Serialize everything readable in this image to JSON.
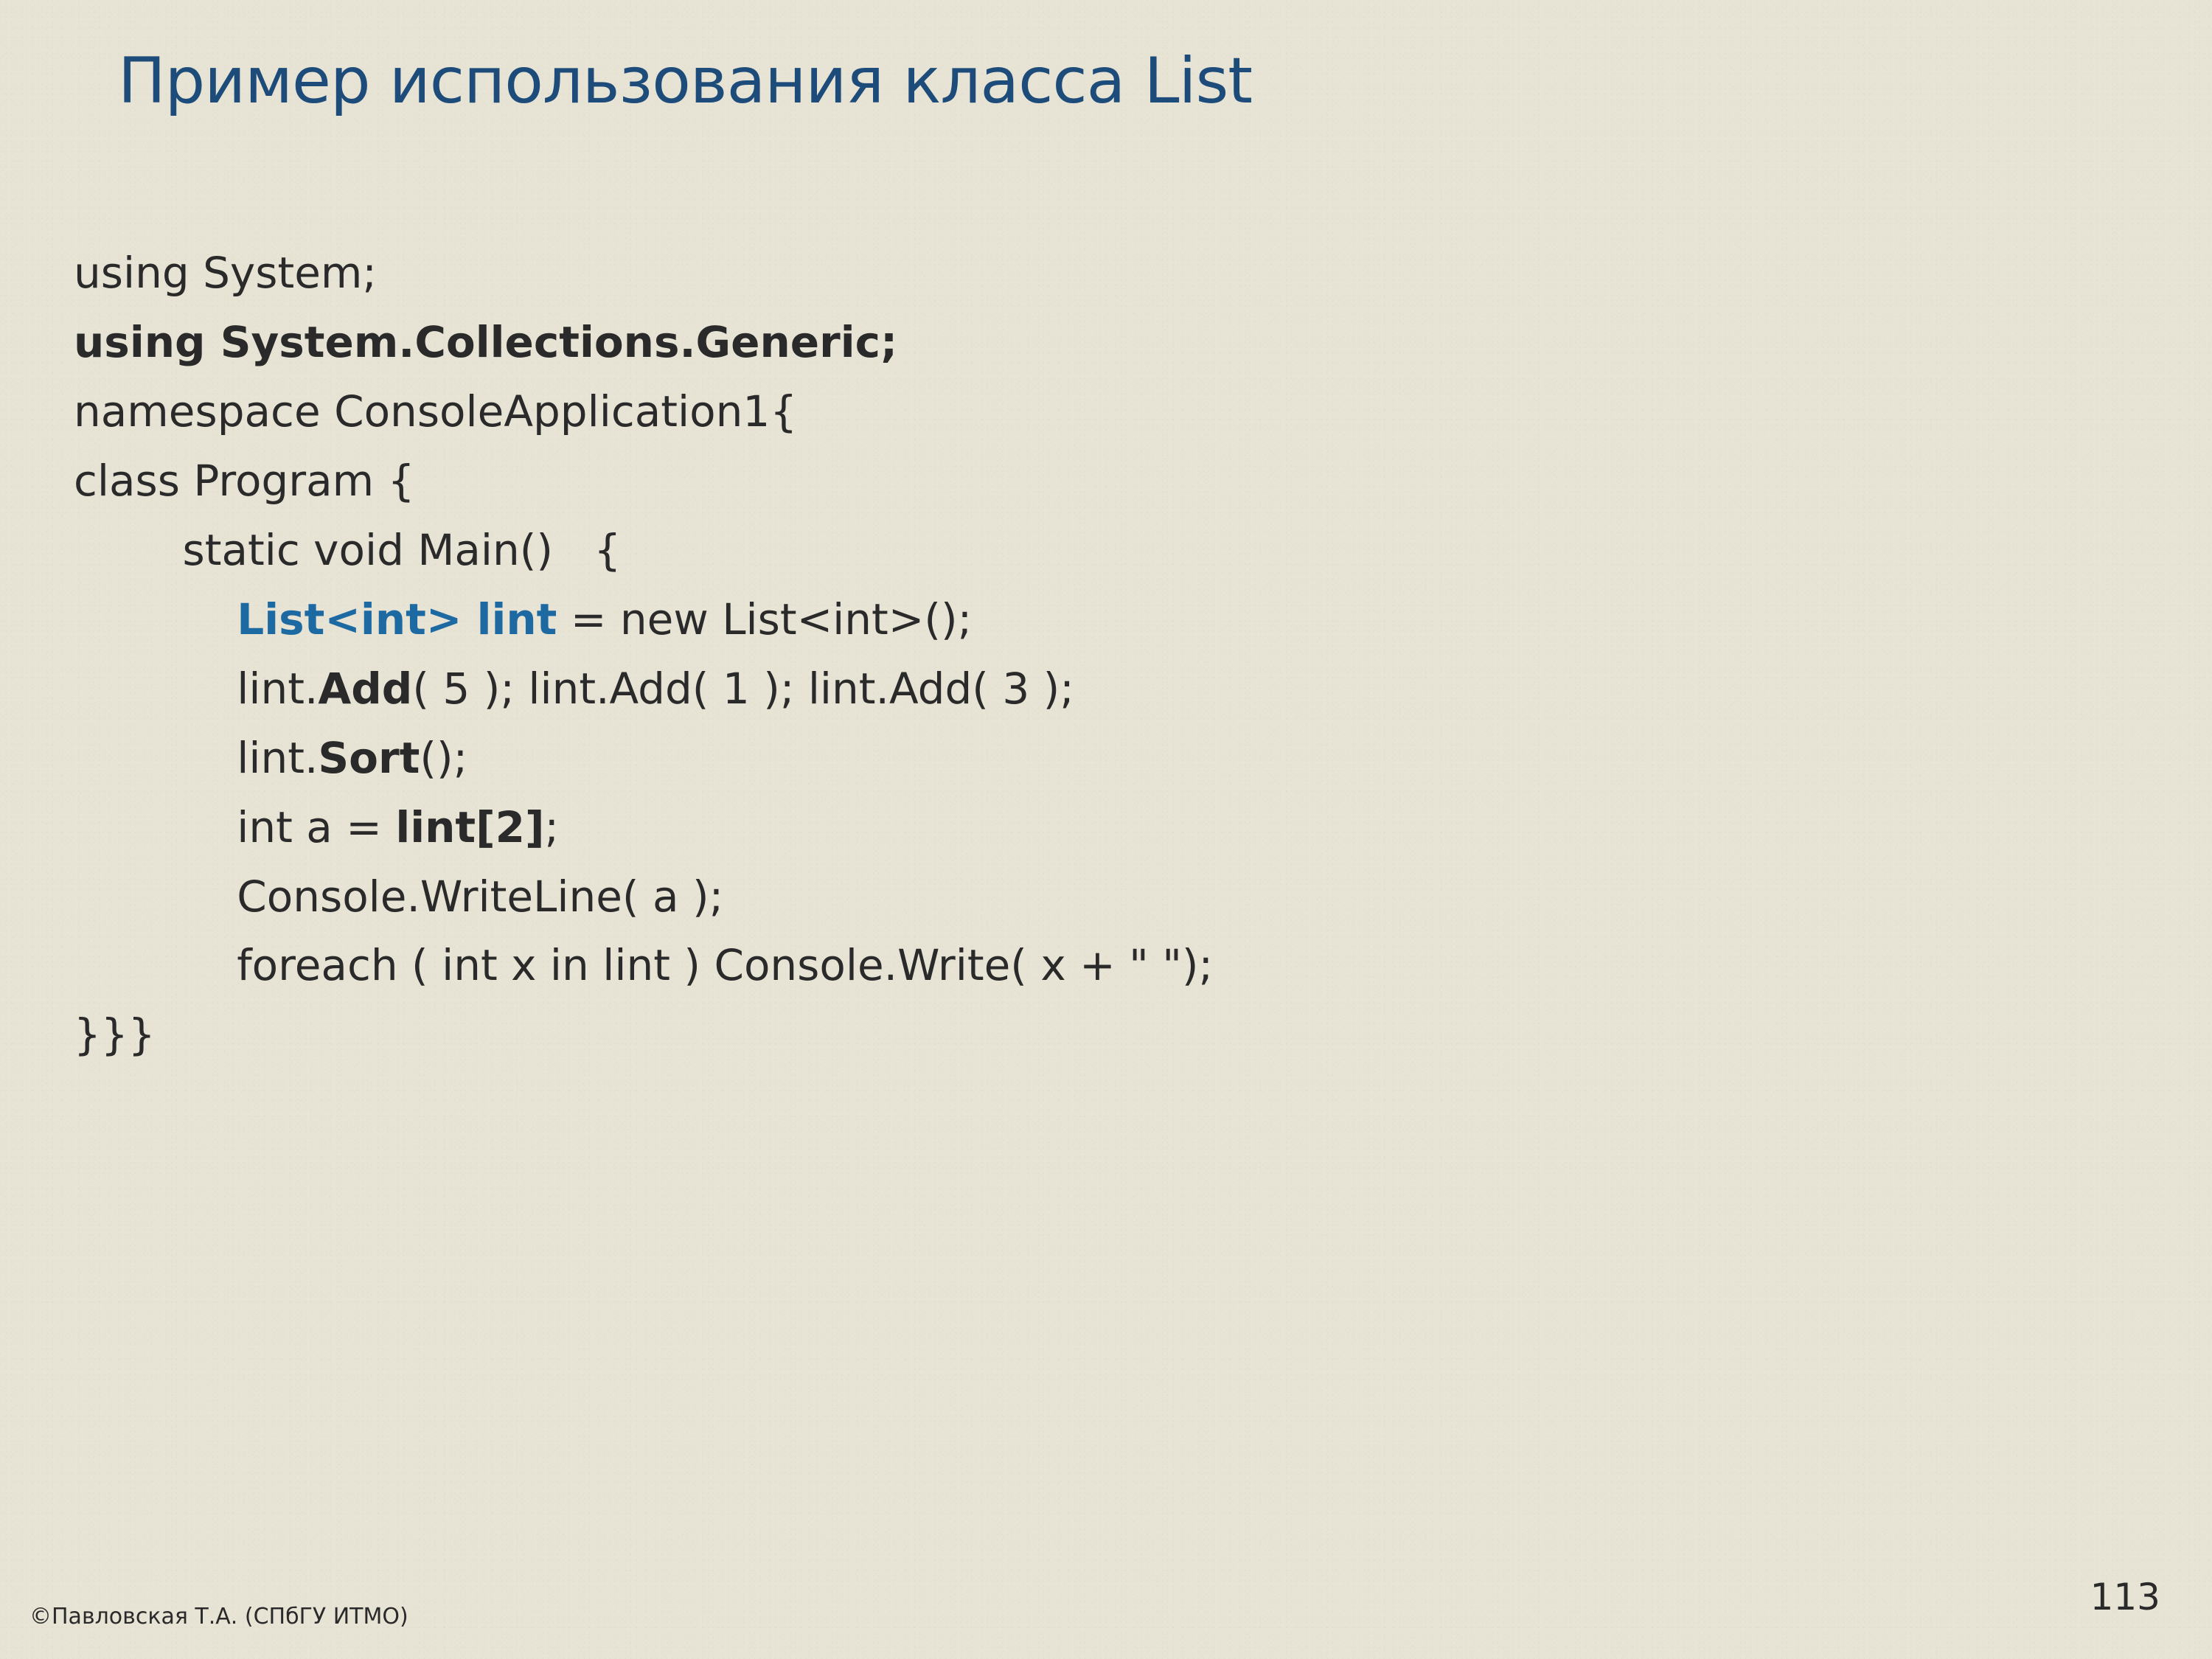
{
  "title": "Пример использования класса List",
  "code": {
    "l1": "using System;",
    "l2": "using System.Collections.Generic;",
    "l3": "namespace ConsoleApplication1{",
    "l4": "class Program {",
    "l5": "        static void Main()   {",
    "l6a": "            ",
    "l6b": "List<int> lint",
    "l6c": " = new List<int>();",
    "l7a": "            lint.",
    "l7b": "Add",
    "l7c": "( 5 ); lint.Add( 1 ); lint.Add( 3 );",
    "l8a": "            lint.",
    "l8b": "Sort",
    "l8c": "();",
    "l9a": "            int a = ",
    "l9b": "lint[2]",
    "l9c": ";",
    "l10": "            Console.WriteLine( a );",
    "l11": "            foreach ( int x in lint ) Console.Write( x + \" \");",
    "l12": "}}}"
  },
  "footer": {
    "copyright": "©Павловская Т.А. (СПбГУ ИТМО)",
    "page": "113"
  }
}
